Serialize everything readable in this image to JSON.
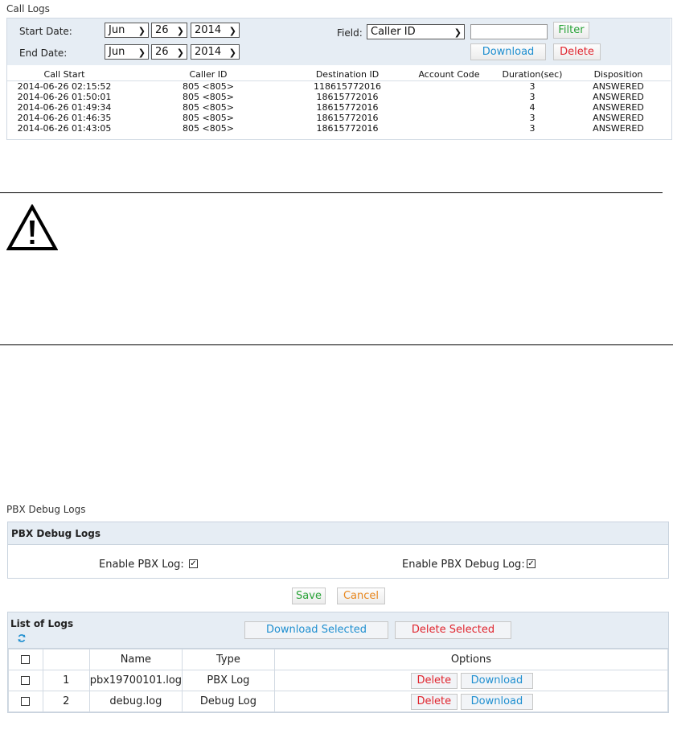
{
  "call_logs": {
    "title": "Call Logs",
    "start_label": "Start Date:",
    "end_label": "End Date:",
    "start": {
      "month": "Jun",
      "day": "26",
      "year": "2014"
    },
    "end": {
      "month": "Jun",
      "day": "26",
      "year": "2014"
    },
    "field_label": "Field:",
    "field_value": "Caller ID",
    "filter_value": "",
    "filter_button": "Filter",
    "download_button": "Download",
    "delete_button": "Delete",
    "columns": [
      "Call Start",
      "Caller ID",
      "Destination ID",
      "Account Code",
      "Duration(sec)",
      "Disposition"
    ],
    "rows": [
      [
        "2014-06-26 02:15:52",
        "805 <805>",
        "118615772016",
        "",
        "3",
        "ANSWERED"
      ],
      [
        "2014-06-26 01:50:01",
        "805 <805>",
        "18615772016",
        "",
        "3",
        "ANSWERED"
      ],
      [
        "2014-06-26 01:49:34",
        "805 <805>",
        "18615772016",
        "",
        "4",
        "ANSWERED"
      ],
      [
        "2014-06-26 01:46:35",
        "805 <805>",
        "18615772016",
        "",
        "3",
        "ANSWERED"
      ],
      [
        "2014-06-26 01:43:05",
        "805 <805>",
        "18615772016",
        "",
        "3",
        "ANSWERED"
      ]
    ]
  },
  "warning": {
    "icon": "warning-triangle-icon"
  },
  "pbx_debug": {
    "page_title": "PBX Debug Logs",
    "section_title": "PBX Debug Logs",
    "enable_pbx_log_label": "Enable PBX Log:",
    "enable_pbx_log_checked": true,
    "enable_debug_log_label": "Enable PBX Debug Log:",
    "enable_debug_log_checked": true,
    "save_button": "Save",
    "cancel_button": "Cancel"
  },
  "list_of_logs": {
    "title": "List of Logs",
    "refresh_icon": "refresh-icon",
    "download_selected": "Download Selected",
    "delete_selected": "Delete Selected",
    "columns": {
      "name": "Name",
      "type": "Type",
      "options": "Options"
    },
    "rows": [
      {
        "index": "1",
        "name": "pbx19700101.log",
        "type": "PBX Log",
        "delete": "Delete",
        "download": "Download"
      },
      {
        "index": "2",
        "name": "debug.log",
        "type": "Debug Log",
        "delete": "Delete",
        "download": "Download"
      }
    ]
  },
  "colors": {
    "accent_blue": "#1f8fd0",
    "danger_red": "#e0252e",
    "success_green": "#29a338",
    "warn_orange": "#e8871e",
    "panel_bg": "#e6edf4"
  }
}
